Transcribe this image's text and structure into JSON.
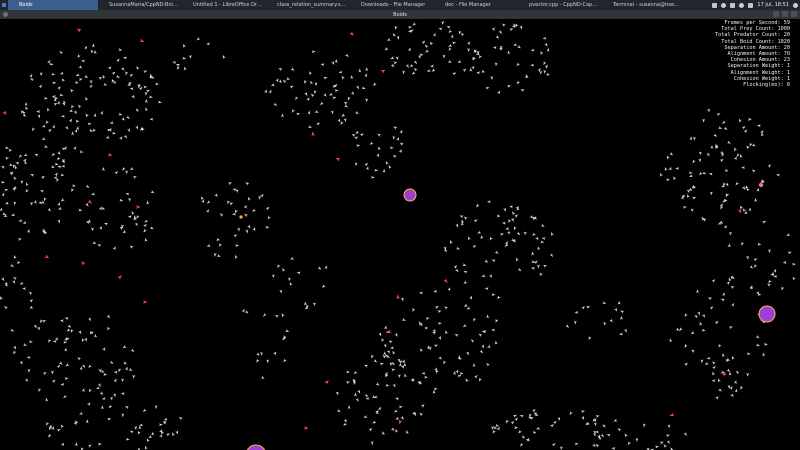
{
  "taskbar": {
    "tasks": [
      {
        "label": "Boids",
        "icon": "app-icon",
        "color": "#6b7f99",
        "active": true
      },
      {
        "label": "SusannaMaria/CppND-Boid...",
        "icon": "firefox-icon",
        "color": "#e66000"
      },
      {
        "label": "Untitled 1 - LibreOffice Draw",
        "icon": "draw-icon",
        "color": "#f2b233"
      },
      {
        "label": "class_relation_summary.svg...",
        "icon": "image-icon",
        "color": "#e8e8e8"
      },
      {
        "label": "Downloads - File Manager",
        "icon": "folder-icon",
        "color": "#8bbf3f"
      },
      {
        "label": "doc - File Manager",
        "icon": "folder-icon",
        "color": "#d9a441"
      },
      {
        "label": "pvector.cpp - CppND-Caps...",
        "icon": "vscode-icon",
        "color": "#2f80d1"
      },
      {
        "label": "Terminal - susanna@tower...",
        "icon": "terminal-icon",
        "color": "#3c3f45"
      }
    ],
    "clock": "17 Jul, 18:51"
  },
  "window": {
    "title": "Boids"
  },
  "stats": [
    {
      "label": "Frames per Second",
      "value": "59"
    },
    {
      "label": "Total Prey Count",
      "value": "1000"
    },
    {
      "label": "Total Predator Count",
      "value": "20"
    },
    {
      "label": "Total Boid Count",
      "value": "1020"
    },
    {
      "label": "Separation Amount",
      "value": "20"
    },
    {
      "label": "Alignment Amount",
      "value": "70"
    },
    {
      "label": "Cohesion Amount",
      "value": "23"
    },
    {
      "label": "Separation Weight",
      "value": "1"
    },
    {
      "label": "Alignment Weight",
      "value": "1"
    },
    {
      "label": "Cohesion Weight",
      "value": "1"
    },
    {
      "label": "Flocking(ms)",
      "value": "0"
    }
  ],
  "colors": {
    "background": "#000000",
    "prey": "#d2d2d2",
    "predator": "#ff3b6a",
    "obstacle_fill": "#9b3fd6",
    "obstacle_outline": "#ffb347"
  }
}
